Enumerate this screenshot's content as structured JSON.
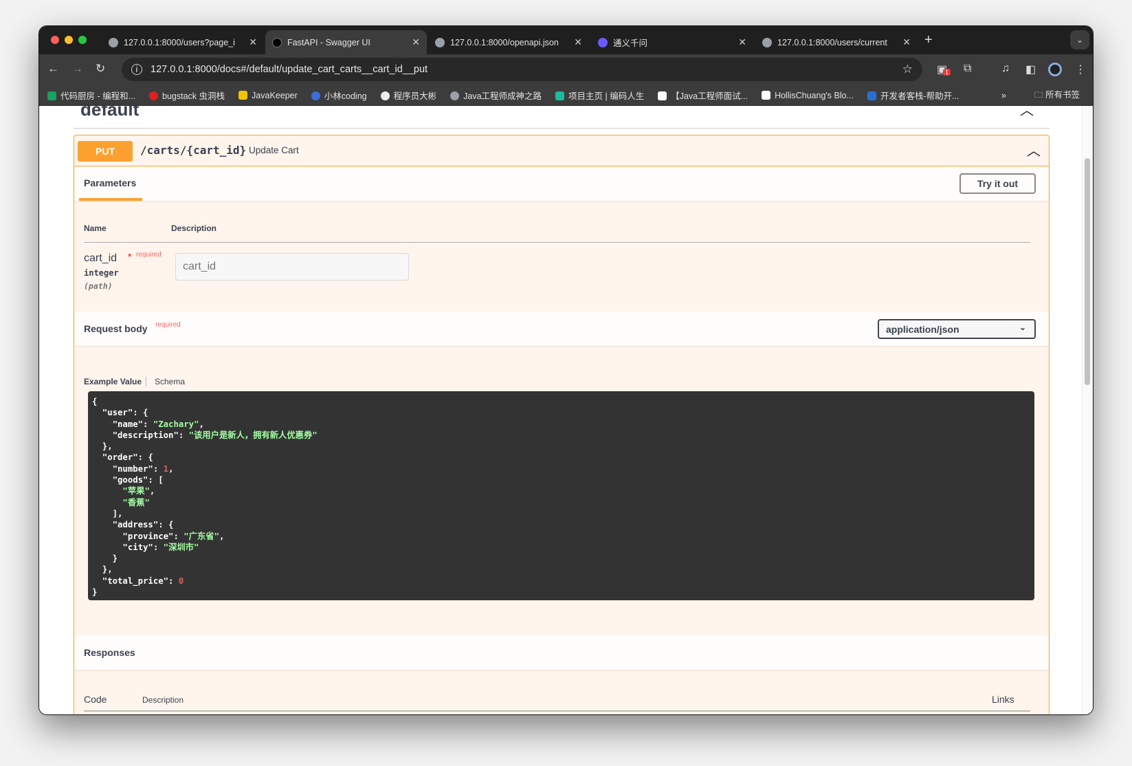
{
  "browser": {
    "tabs": [
      {
        "title": "127.0.0.1:8000/users?page_i"
      },
      {
        "title": "FastAPI - Swagger UI"
      },
      {
        "title": "127.0.0.1:8000/openapi.json"
      },
      {
        "title": "通义千问"
      },
      {
        "title": "127.0.0.1:8000/users/current"
      }
    ],
    "url": "127.0.0.1:8000/docs#/default/update_cart_carts__cart_id__put",
    "extension_badge": "1",
    "bookmarks": [
      {
        "label": "代码厨房 - 编程和...",
        "color": "#1aa260"
      },
      {
        "label": "bugstack 虫洞栈",
        "color": "#e02020"
      },
      {
        "label": "JavaKeeper",
        "color": "#f3c300"
      },
      {
        "label": "小林coding",
        "color": "#3a6fd8"
      },
      {
        "label": "程序员大彬",
        "color": "#eee"
      },
      {
        "label": "Java工程师成神之路",
        "color": "#9aa0a6"
      },
      {
        "label": "项目主页 | 编码人生",
        "color": "#1abc9c"
      },
      {
        "label": "【Java工程师面试...",
        "color": "#fff"
      },
      {
        "label": "HollisChuang's Blo...",
        "color": "#fff"
      },
      {
        "label": "开发者客栈-帮助开...",
        "color": "#2a6fd6"
      }
    ],
    "more": "»",
    "all_bookmarks": "所有书签"
  },
  "page": {
    "section_title": "default",
    "method": "PUT",
    "path": "/carts/{cart_id}",
    "summary": "Update Cart",
    "parameters_tab": "Parameters",
    "try_button": "Try it out",
    "col_name": "Name",
    "col_description": "Description",
    "param": {
      "name": "cart_id",
      "star": "*",
      "required": "required",
      "type": "integer",
      "in": "(path)",
      "placeholder": "cart_id"
    },
    "request_body": "Request body",
    "request_required": "required",
    "content_type": "application/json",
    "example_tab": "Example Value",
    "schema_tab": "Schema",
    "example": {
      "name": "Zachary",
      "description": "该用户是新人，拥有新人优惠券",
      "number": "1",
      "goods": [
        "苹果",
        "香蕉"
      ],
      "province": "广东省",
      "city": "深圳市",
      "total_price": "0"
    },
    "responses": "Responses",
    "resp_code": "Code",
    "resp_description": "Description",
    "resp_links": "Links"
  },
  "colors": {
    "put": "#fca130",
    "bg": "#fff5ec",
    "code_bg": "#333333"
  }
}
